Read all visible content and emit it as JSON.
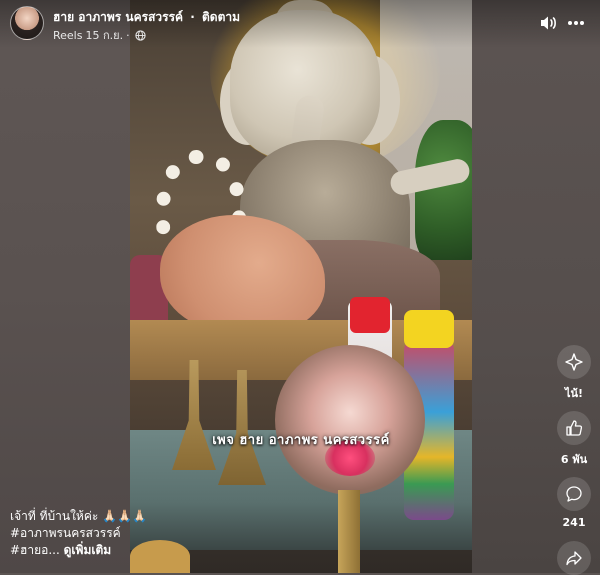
{
  "post": {
    "author": "ฮาย อาภาพร นครสวรรค์",
    "separator": "·",
    "follow_label": "ติดตาม",
    "source": "Reels",
    "date": "15 ก.ย.",
    "meta_separator": "·",
    "privacy_icon": "globe-icon"
  },
  "video": {
    "caption_overlay": "เพจ ฮาย อาภาพร นครสวรรค์"
  },
  "controls": {
    "sound_icon": "speaker-icon",
    "more_icon": "more-icon"
  },
  "actions": {
    "react_label": "ไน้!",
    "like_count": "6 พัน",
    "comment_count": "241",
    "share_icon": "share-icon"
  },
  "description": {
    "line1": "เจ้าที่ ที่บ้านให้ค่ะ 🙏🏻🙏🏻🙏🏻",
    "hashtag1": "#อาภาพรนครสวรรค์",
    "hashtag2": "#ฮายอ...",
    "see_more": "ดูเพิ่มเติม"
  },
  "colors": {
    "background": "#5b5452",
    "text": "#ffffff"
  }
}
